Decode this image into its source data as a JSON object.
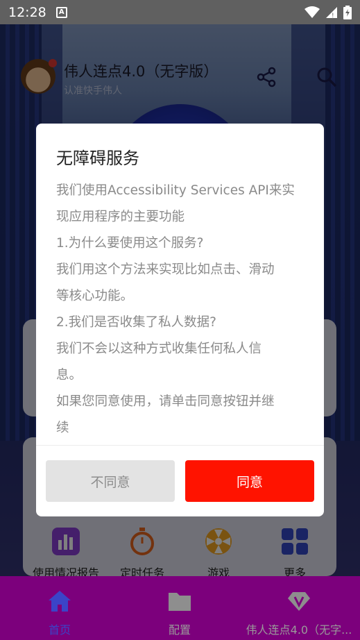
{
  "status_bar": {
    "time": "12:28",
    "notification_icon": "A"
  },
  "header": {
    "title": "伟人连点4.0（无字版）",
    "subtitle": "认准快手伟人"
  },
  "features": [
    {
      "label": "使用情况报告",
      "icon": "bar-chart-icon"
    },
    {
      "label": "定时任务",
      "icon": "timer-icon"
    },
    {
      "label": "游戏",
      "icon": "game-icon"
    },
    {
      "label": "更多",
      "icon": "grid-icon"
    }
  ],
  "dialog": {
    "title": "无障碍服务",
    "lines": [
      "我们使用Accessibility Services API来实",
      "现应用程序的主要功能",
      "1.为什么要使用这个服务?",
      "我们用这个方法来实现比如点击、滑动",
      "等核心功能。",
      "2.我们是否收集了私人数据?",
      "我们不会以这种方式收集任何私人信",
      "息。",
      "如果您同意使用，请单击同意按钮并继",
      "续"
    ],
    "disagree_label": "不同意",
    "agree_label": "同意"
  },
  "bottom_nav": [
    {
      "label": "首页",
      "icon": "home-icon"
    },
    {
      "label": "配置",
      "icon": "folder-icon"
    },
    {
      "label": "伟人连点4.0（无字...",
      "icon": "vip-icon"
    }
  ],
  "colors": {
    "accent": "#ff1300",
    "nav_bg": "#7c007c",
    "nav_active": "#3b44c8"
  }
}
